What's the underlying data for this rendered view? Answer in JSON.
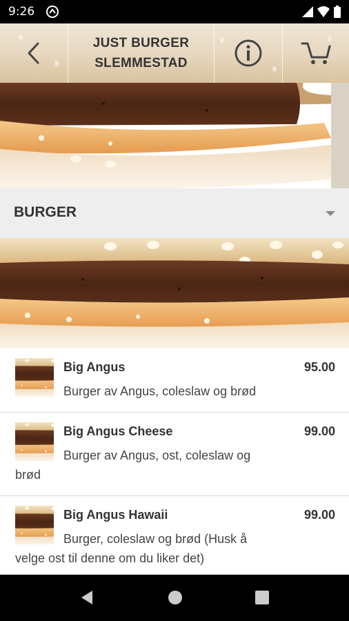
{
  "status_bar": {
    "time": "9:26"
  },
  "header": {
    "title_line1": "JUST BURGER",
    "title_line2": "SLEMMESTAD"
  },
  "category": {
    "label": "BURGER"
  },
  "menu": {
    "items": [
      {
        "name": "Big Angus",
        "price": "95.00",
        "description": "Burger av Angus, coleslaw og brød"
      },
      {
        "name": "Big Angus Cheese",
        "price": "99.00",
        "description": "Burger av Angus, ost, coleslaw og brød"
      },
      {
        "name": "Big Angus Hawaii",
        "price": "99.00",
        "description": "Burger, coleslaw og brød (Husk å velge ost til denne om du liker det)"
      }
    ]
  },
  "colors": {
    "header_bg": "#e6d6bd",
    "category_bg": "#eeeeee",
    "text": "#333333"
  },
  "icons": [
    "back-icon",
    "info-icon",
    "cart-icon",
    "back-nav-icon",
    "home-nav-icon",
    "recents-nav-icon"
  ]
}
